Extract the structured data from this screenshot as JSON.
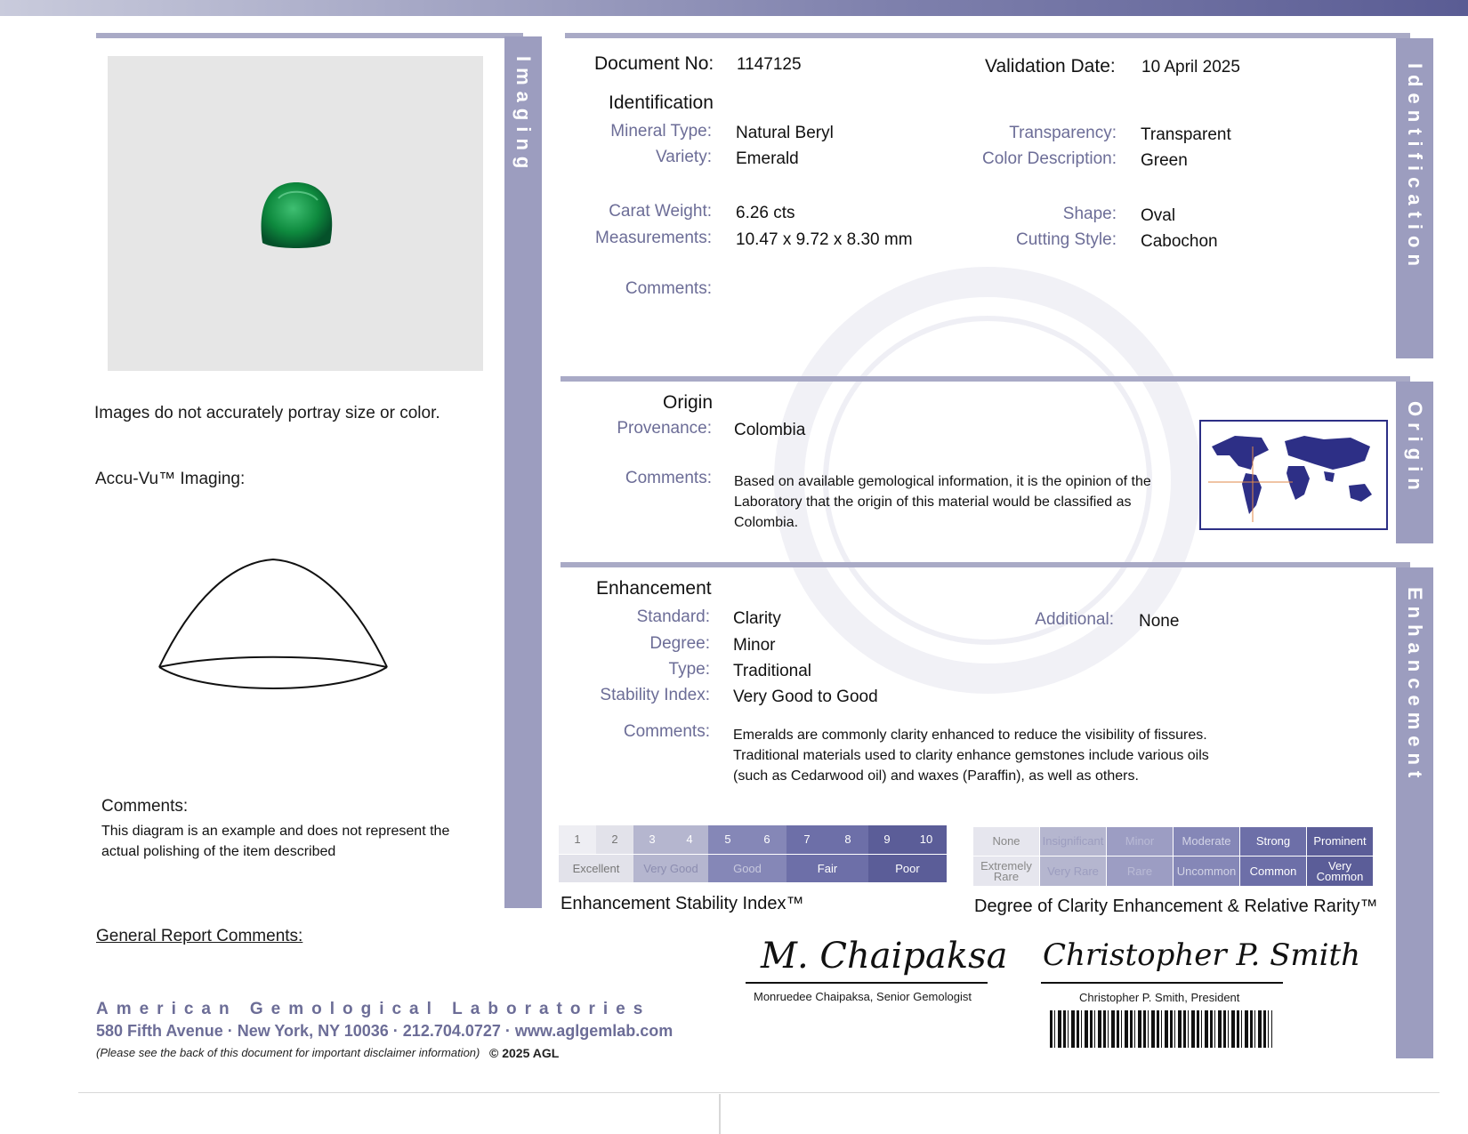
{
  "side_labels": {
    "imaging": "Imaging",
    "identification": "Identification",
    "origin": "Origin",
    "enhancement": "Enhancement"
  },
  "imaging": {
    "disclaimer": "Images do not accurately portray size or color.",
    "accuvu": "Accu-Vu™ Imaging:",
    "comments_label": "Comments:",
    "comments": "This diagram is an example and does not represent the actual polishing of the item described"
  },
  "header": {
    "doc_label": "Document No:",
    "doc_value": "1147125",
    "date_label": "Validation Date:",
    "date_value": "10 April 2025"
  },
  "identification": {
    "heading": "Identification",
    "mineral_label": "Mineral Type:",
    "mineral_value": "Natural Beryl",
    "variety_label": "Variety:",
    "variety_value": "Emerald",
    "transparency_label": "Transparency:",
    "transparency_value": "Transparent",
    "color_label": "Color Description:",
    "color_value": "Green",
    "carat_label": "Carat Weight:",
    "carat_value": "6.26 cts",
    "meas_label": "Measurements:",
    "meas_value": "10.47 x 9.72 x 8.30 mm",
    "shape_label": "Shape:",
    "shape_value": "Oval",
    "cut_label": "Cutting Style:",
    "cut_value": "Cabochon",
    "comments_label": "Comments:"
  },
  "origin": {
    "heading": "Origin",
    "prov_label": "Provenance:",
    "prov_value": "Colombia",
    "comments_label": "Comments:",
    "comments": "Based on available gemological information, it is the opinion of the Laboratory that the origin of this material would be classified as Colombia."
  },
  "enhancement": {
    "heading": "Enhancement",
    "standard_label": "Standard:",
    "standard_value": "Clarity",
    "additional_label": "Additional:",
    "additional_value": "None",
    "degree_label": "Degree:",
    "degree_value": "Minor",
    "type_label": "Type:",
    "type_value": "Traditional",
    "stability_label": "Stability Index:",
    "stability_value": "Very Good to Good",
    "comments_label": "Comments:",
    "comments": "Emeralds are commonly clarity enhanced to reduce the visibility of fissures. Traditional materials used to clarity enhance gemstones include various oils (such as Cedarwood oil) and waxes (Paraffin), as well as others."
  },
  "scales": {
    "stability_numbers": [
      "1",
      "2",
      "3",
      "4",
      "5",
      "6",
      "7",
      "8",
      "9",
      "10"
    ],
    "stability_words": [
      "Excellent",
      "Very Good",
      "Good",
      "Fair",
      "Poor"
    ],
    "stability_caption": "Enhancement Stability Index™",
    "degree_top": [
      "None",
      "Insignificant",
      "Minor",
      "Moderate",
      "Strong",
      "Prominent"
    ],
    "degree_bottom": [
      "Extremely Rare",
      "Very Rare",
      "Rare",
      "Uncommon",
      "Common",
      "Very Common"
    ],
    "degree_caption": "Degree of Clarity Enhancement & Relative Rarity™"
  },
  "footer": {
    "general_comments": "General Report Comments:",
    "lab_name": "American Gemological Laboratories",
    "address": "580 Fifth Avenue · New York, NY 10036 · 212.704.0727 · www.aglgemlab.com",
    "disclaimer": "(Please see the back of this document for important disclaimer information)",
    "copyright": "© 2025 AGL",
    "sig1_script": "M. Chaipaksa",
    "sig1_name": "Monruedee Chaipaksa, Senior Gemologist",
    "sig2_script": "Christopher P. Smith",
    "sig2_name": "Christopher P. Smith, President"
  },
  "colors": {
    "accent": "#9c9dbf",
    "dark_cell": "#5b5d98",
    "emerald": "#0e8a3e",
    "map": "#2d2f86"
  }
}
